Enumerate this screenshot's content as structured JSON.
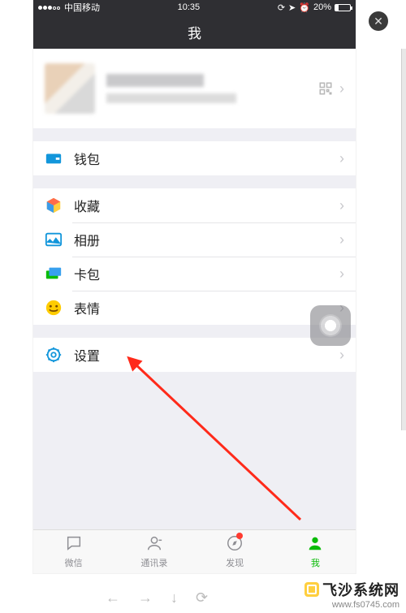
{
  "statusbar": {
    "carrier": "中国移动",
    "time": "10:35",
    "battery_pct": "20%",
    "icons": [
      "lock",
      "location",
      "alarm"
    ]
  },
  "navbar": {
    "title": "我"
  },
  "profile": {
    "qr_icon": "qr-code"
  },
  "sections": [
    {
      "rows": [
        {
          "icon": "wallet-icon",
          "label": "钱包",
          "color": "#1296db"
        }
      ]
    },
    {
      "rows": [
        {
          "icon": "cube-icon",
          "label": "收藏",
          "color": "#ff3b30"
        },
        {
          "icon": "photo-icon",
          "label": "相册",
          "color": "#1296db"
        },
        {
          "icon": "card-icon",
          "label": "卡包",
          "color": "#09bb07"
        },
        {
          "icon": "emoji-icon",
          "label": "表情",
          "color": "#ffcc00"
        }
      ]
    },
    {
      "rows": [
        {
          "icon": "gear-icon",
          "label": "设置",
          "color": "#1296db"
        }
      ]
    }
  ],
  "tabs": [
    {
      "icon": "chat",
      "label": "微信"
    },
    {
      "icon": "contacts",
      "label": "通讯录"
    },
    {
      "icon": "discover",
      "label": "发现",
      "badge": true
    },
    {
      "icon": "me",
      "label": "我",
      "active": true
    }
  ],
  "overlay": {
    "close_label": "✕"
  },
  "toolbar": {
    "back": "←",
    "forward": "→",
    "download": "↓",
    "refresh": "⟳"
  },
  "watermark": {
    "line1": "飞沙系统网",
    "line2": "www.fs0745.com"
  }
}
